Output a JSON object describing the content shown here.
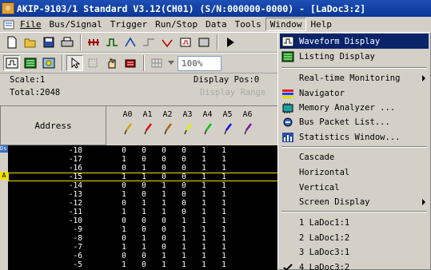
{
  "window": {
    "title": "AKIP-9103/1 Standard V3.12(CH01) (S/N:000000-0000) - [LaDoc3:2]"
  },
  "menubar": {
    "items": [
      "File",
      "Bus/Signal",
      "Trigger",
      "Run/Stop",
      "Data",
      "Tools",
      "Window",
      "Help"
    ],
    "open_item": "Window"
  },
  "toolbar": {
    "zoom_value": "100%"
  },
  "info": {
    "scale": "Scale:1",
    "total": "Total:2048",
    "display_pos": "Display Pos:0",
    "display_range": "Display Range"
  },
  "grid": {
    "address_header": "Address",
    "channel_headers": [
      "A0",
      "A1",
      "A2",
      "A3",
      "A4",
      "A5",
      "A6"
    ],
    "channel_colors": [
      "#d4a017",
      "#e01010",
      "#b06010",
      "#e8e800",
      "#10c010",
      "#1010e0",
      "#8010a0"
    ],
    "markers": {
      "ds": "Ds",
      "a": "A"
    },
    "rows": [
      {
        "addr": "-18",
        "bits": [
          "0",
          "0",
          "0",
          "0",
          "1",
          "1"
        ]
      },
      {
        "addr": "-17",
        "bits": [
          "1",
          "0",
          "0",
          "0",
          "1",
          "1"
        ]
      },
      {
        "addr": "-16",
        "bits": [
          "0",
          "1",
          "0",
          "0",
          "1",
          "1"
        ]
      },
      {
        "addr": "-15",
        "bits": [
          "1",
          "1",
          "0",
          "0",
          "1",
          "1"
        ]
      },
      {
        "addr": "-14",
        "bits": [
          "0",
          "0",
          "1",
          "0",
          "1",
          "1"
        ]
      },
      {
        "addr": "-13",
        "bits": [
          "1",
          "0",
          "1",
          "0",
          "1",
          "1"
        ]
      },
      {
        "addr": "-12",
        "bits": [
          "0",
          "1",
          "1",
          "0",
          "1",
          "1"
        ]
      },
      {
        "addr": "-11",
        "bits": [
          "1",
          "1",
          "1",
          "0",
          "1",
          "1"
        ]
      },
      {
        "addr": "-10",
        "bits": [
          "0",
          "0",
          "0",
          "1",
          "1",
          "1"
        ]
      },
      {
        "addr": "-9",
        "bits": [
          "1",
          "0",
          "0",
          "1",
          "1",
          "1"
        ]
      },
      {
        "addr": "-8",
        "bits": [
          "0",
          "1",
          "0",
          "1",
          "1",
          "1"
        ]
      },
      {
        "addr": "-7",
        "bits": [
          "1",
          "1",
          "0",
          "1",
          "1",
          "1"
        ]
      },
      {
        "addr": "-6",
        "bits": [
          "0",
          "0",
          "1",
          "1",
          "1",
          "1"
        ]
      },
      {
        "addr": "-5",
        "bits": [
          "1",
          "0",
          "1",
          "1",
          "1",
          "1"
        ]
      }
    ]
  },
  "window_menu": {
    "items": [
      {
        "label": "Waveform Display",
        "icon": "waveform-icon",
        "highlighted": true
      },
      {
        "label": "Listing Display",
        "icon": "listing-icon"
      },
      {
        "label": "Real-time Monitoring",
        "submenu": true
      },
      {
        "label": "Navigator",
        "icon": "navigator-icon"
      },
      {
        "label": "Memory Analyzer ...",
        "icon": "memory-icon"
      },
      {
        "label": "Bus Packet List...",
        "icon": "bus-packet-icon"
      },
      {
        "label": "Statistics Window...",
        "icon": "statistics-icon"
      },
      {
        "label": "Cascade"
      },
      {
        "label": "Horizontal"
      },
      {
        "label": "Vertical"
      },
      {
        "label": "Screen Display",
        "submenu": true
      },
      {
        "label": "1 LaDoc1:1"
      },
      {
        "label": "2 LaDoc1:2"
      },
      {
        "label": "3 LaDoc3:1"
      },
      {
        "label": "4 LaDoc3:2",
        "checked": true
      }
    ]
  }
}
